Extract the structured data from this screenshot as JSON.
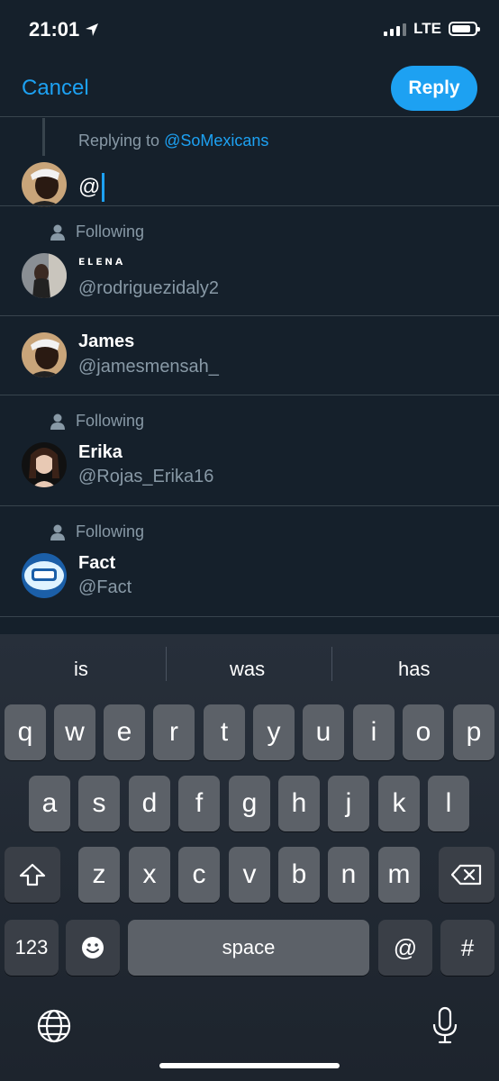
{
  "status": {
    "time": "21:01",
    "network": "LTE",
    "battery_level": 0.85
  },
  "header": {
    "cancel_label": "Cancel",
    "reply_label": "Reply"
  },
  "compose": {
    "replying_prefix": "Replying to",
    "replying_handle": "@SoMexicans",
    "text": "@"
  },
  "suggestions": [
    {
      "following_label": "Following",
      "name": "ᴇʟᴇɴᴀ",
      "handle": "@rodriguezidaly2"
    },
    {
      "following_label": "",
      "name": "James",
      "handle": "@jamesmensah_"
    },
    {
      "following_label": "Following",
      "name": "Erika",
      "handle": "@Rojas_Erika16"
    },
    {
      "following_label": "Following",
      "name": "Fact",
      "handle": "@Fact"
    }
  ],
  "keyboard": {
    "predictions": [
      "is",
      "was",
      "has"
    ],
    "row1": [
      "q",
      "w",
      "e",
      "r",
      "t",
      "y",
      "u",
      "i",
      "o",
      "p"
    ],
    "row2": [
      "a",
      "s",
      "d",
      "f",
      "g",
      "h",
      "j",
      "k",
      "l"
    ],
    "row3": [
      "z",
      "x",
      "c",
      "v",
      "b",
      "n",
      "m"
    ],
    "numbers_label": "123",
    "space_label": "space",
    "at_label": "@",
    "hash_label": "#"
  },
  "colors": {
    "accent": "#1da1f2",
    "background": "#15202b",
    "secondary_text": "#8899a6"
  }
}
